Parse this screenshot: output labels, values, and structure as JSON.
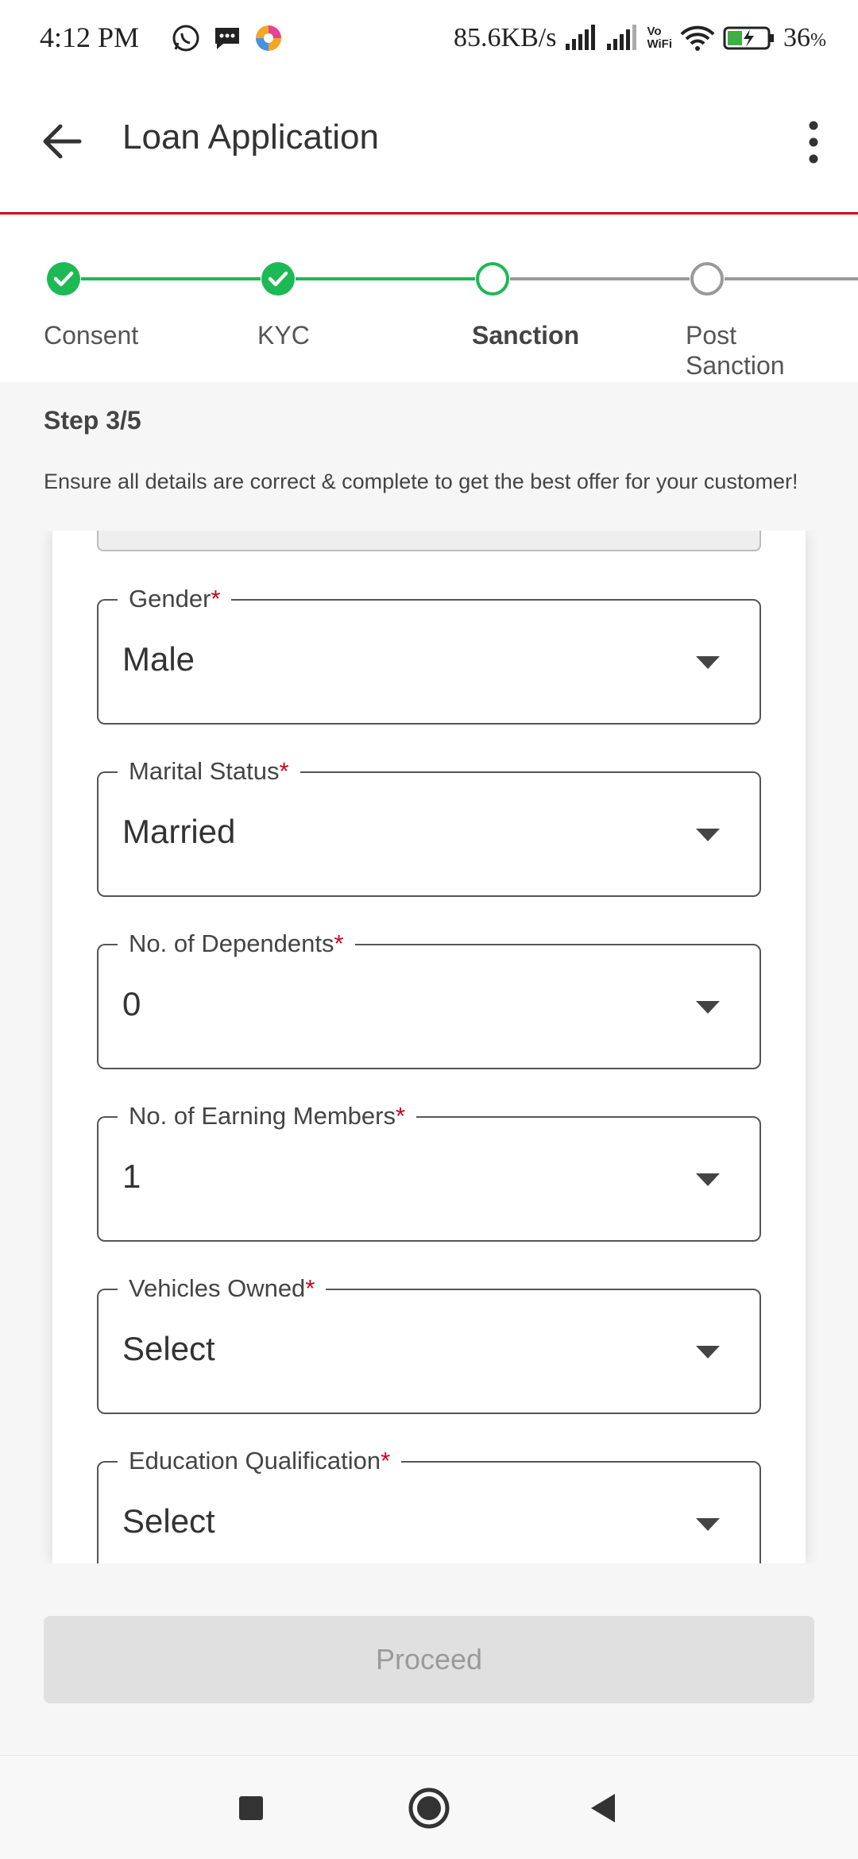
{
  "status_bar": {
    "time": "4:12 PM",
    "network_speed": "85.6KB/s",
    "wifi_label_top": "Vo",
    "wifi_label_bottom": "WiFi",
    "battery": "36",
    "battery_unit": "%",
    "app_icons": [
      "whatsapp-icon",
      "messages-icon",
      "browser-icon"
    ]
  },
  "app_bar": {
    "title": "Loan Application"
  },
  "stepper": {
    "steps": [
      {
        "label": "Consent",
        "state": "completed"
      },
      {
        "label": "KYC",
        "state": "completed"
      },
      {
        "label": "Sanction",
        "state": "active"
      },
      {
        "label": "Post",
        "label2": "Sanction",
        "state": "pending"
      }
    ],
    "colors": {
      "completed": "#1db954",
      "pending": "#999999"
    }
  },
  "step_info": {
    "step_count": "Step 3/5",
    "description": "Ensure all details are correct & complete to get the best offer for your customer!"
  },
  "form": {
    "fields": [
      {
        "label": "Gender",
        "required_mark": "*",
        "value": "Male"
      },
      {
        "label": "Marital Status",
        "required_mark": "*",
        "value": "Married"
      },
      {
        "label": "No. of Dependents",
        "required_mark": "*",
        "value": "0"
      },
      {
        "label": "No. of Earning Members",
        "required_mark": "*",
        "value": "1"
      },
      {
        "label": "Vehicles Owned",
        "required_mark": "*",
        "value": "Select"
      },
      {
        "label": "Education Qualification",
        "required_mark": "*",
        "value": "Select"
      }
    ]
  },
  "actions": {
    "proceed_label": "Proceed"
  },
  "colors": {
    "accent_red": "#d0021b",
    "success_green": "#1db954",
    "disabled_bg": "#e0e0e0"
  }
}
